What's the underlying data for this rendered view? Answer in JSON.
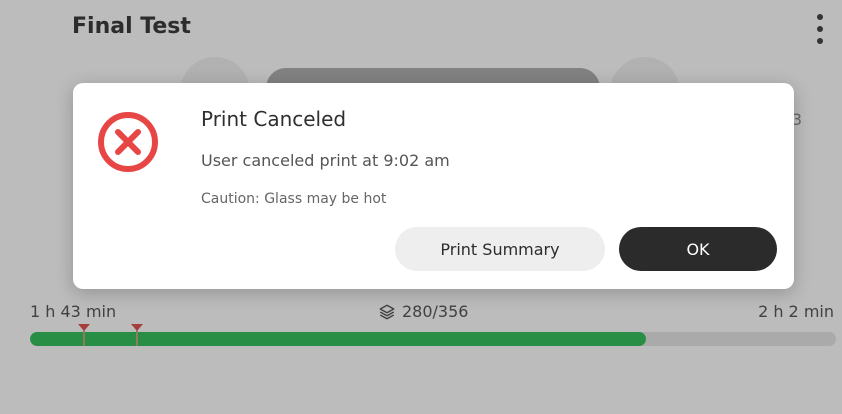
{
  "header": {
    "title": "Final Test"
  },
  "background": {
    "fragment_text": "3"
  },
  "progress": {
    "elapsed": "1 h 43 min",
    "layers": "280/356",
    "remaining": "2 h 2 min",
    "fraction": 0.764,
    "color": "#35b95c",
    "marker_fractions": [
      0.066,
      0.132
    ]
  },
  "dialog": {
    "title": "Print Canceled",
    "message": "User canceled print at 9:02 am",
    "caution": "Caution: Glass may be hot",
    "buttons": {
      "summary": "Print Summary",
      "ok": "OK"
    },
    "icon": "error-x-circle-icon",
    "icon_color": "#e84545"
  }
}
